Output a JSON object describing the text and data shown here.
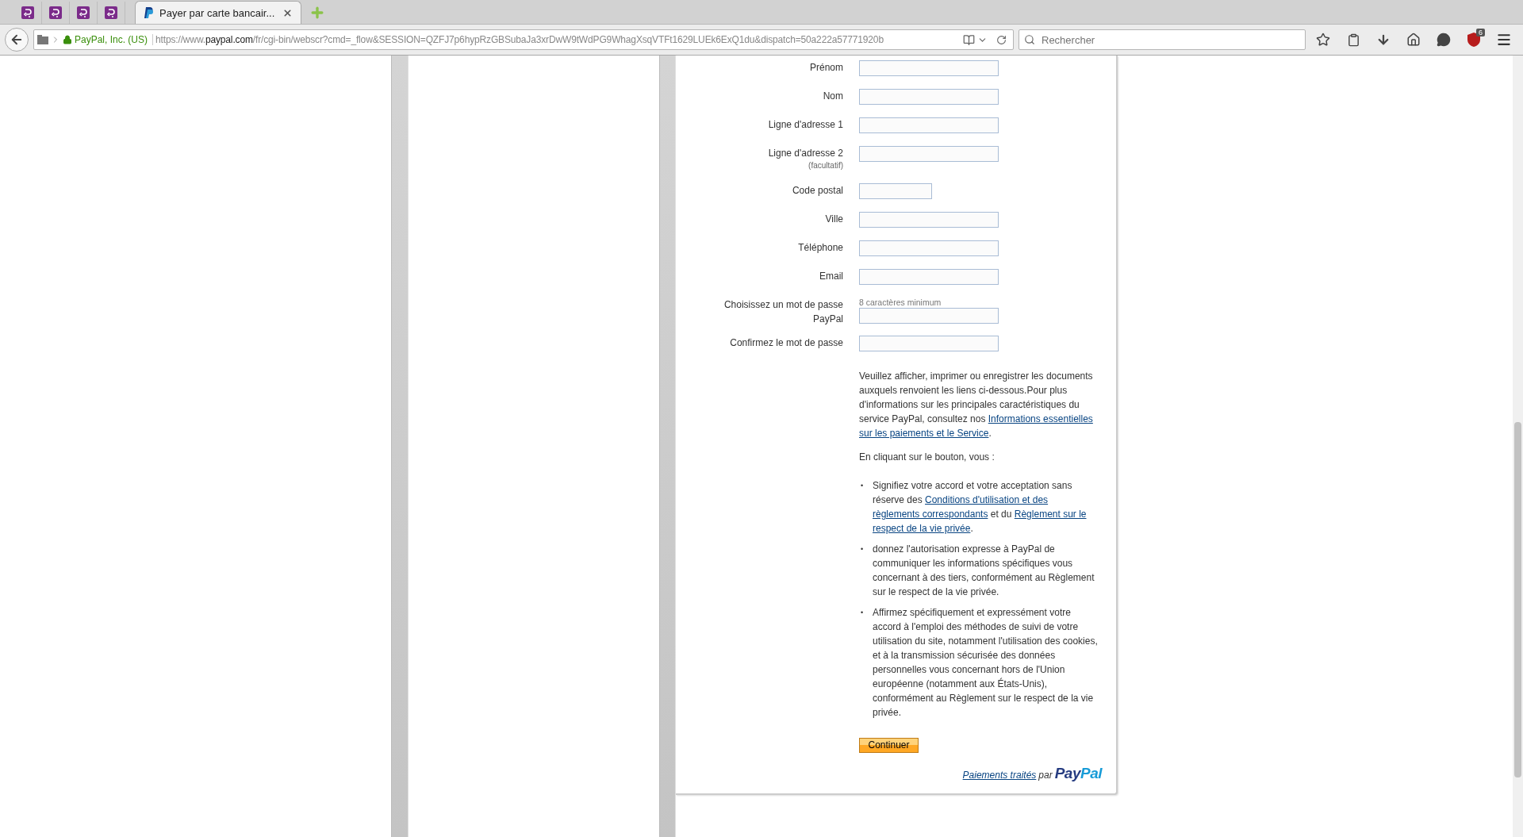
{
  "browser": {
    "tabs": [
      {
        "kind": "pinned",
        "selected": false
      },
      {
        "kind": "pinned",
        "selected": false
      },
      {
        "kind": "pinned",
        "selected": false
      },
      {
        "kind": "pinned",
        "selected": false
      },
      {
        "kind": "page",
        "title": "Payer par carte bancair...",
        "selected": true
      }
    ],
    "identity": "PayPal, Inc. (US)",
    "url": {
      "prefix": "https://www.",
      "domain": "paypal.com",
      "path": "/fr/cgi-bin/webscr?cmd=_flow&SESSION=QZFJ7p6hypRzGBSubaJa3xrDwW9tWdPG9WhagXsqVTFt1629LUEk6ExQ1du&dispatch=50a222a57771920b"
    },
    "search": {
      "placeholder": "Rechercher"
    },
    "addon_badge": "6"
  },
  "form": {
    "fields": [
      {
        "label": "Prénom",
        "kind": "long"
      },
      {
        "label": "Nom",
        "kind": "long"
      },
      {
        "label": "Ligne d'adresse 1",
        "kind": "long"
      },
      {
        "label": "Ligne d'adresse 2",
        "note": "(facultatif)",
        "kind": "long"
      },
      {
        "label": "Code postal",
        "kind": "short"
      },
      {
        "label": "Ville",
        "kind": "long"
      },
      {
        "label": "Téléphone",
        "kind": "long"
      },
      {
        "label": "Email",
        "kind": "long"
      },
      {
        "label": "Choisissez un mot de passe PayPal",
        "hint": "8 caractères minimum",
        "kind": "long"
      },
      {
        "label": "Confirmez le mot de passe",
        "kind": "long"
      }
    ],
    "intro": [
      {
        "kind": "text",
        "text": "Veuillez afficher, imprimer ou enregistrer les documents auxquels renvoient les liens ci-dessous.Pour plus d'informations sur les principales caractéristiques du service PayPal, consultez nos "
      },
      {
        "kind": "link",
        "text": "Informations essentielles"
      },
      {
        "kind": "link",
        "text": "sur les paiements et le Service"
      },
      {
        "kind": "text",
        "text": "."
      }
    ],
    "lead": "En cliquant sur le bouton, vous :",
    "bullets": [
      {
        "marker": "•",
        "segments": [
          {
            "kind": "text",
            "text": "Signifiez votre accord et votre acceptation sans réserve des "
          },
          {
            "kind": "link",
            "text": "Conditions d'utilisation et des"
          },
          {
            "kind": "link",
            "text": "règlements correspondants"
          },
          {
            "kind": "text",
            "text": " et du "
          },
          {
            "kind": "link",
            "text": "Règlement sur le"
          },
          {
            "kind": "link",
            "text": "respect de la vie privée"
          },
          {
            "kind": "text",
            "text": "."
          }
        ]
      },
      {
        "marker": "•",
        "segments": [
          {
            "kind": "text",
            "text": "donnez l'autorisation expresse à PayPal de communiquer les informations spécifiques vous concernant à des tiers, conformément au Règlement sur le respect de la vie privée."
          }
        ]
      },
      {
        "marker": "•",
        "segments": [
          {
            "kind": "text",
            "text": "Affirmez spécifiquement et expressément votre accord à l'emploi des méthodes de suivi de votre utilisation du site, notamment l'utilisation des cookies, et à la transmission sécurisée des données personnelles vous concernant hors de l'Union européenne (notamment aux États-Unis), conformément au Règlement sur le respect de la vie privée."
          }
        ]
      }
    ],
    "button": "Continuer",
    "footer": {
      "link": "Paiements traités",
      "by": "par",
      "logo": [
        "Pay",
        "Pal"
      ]
    }
  }
}
